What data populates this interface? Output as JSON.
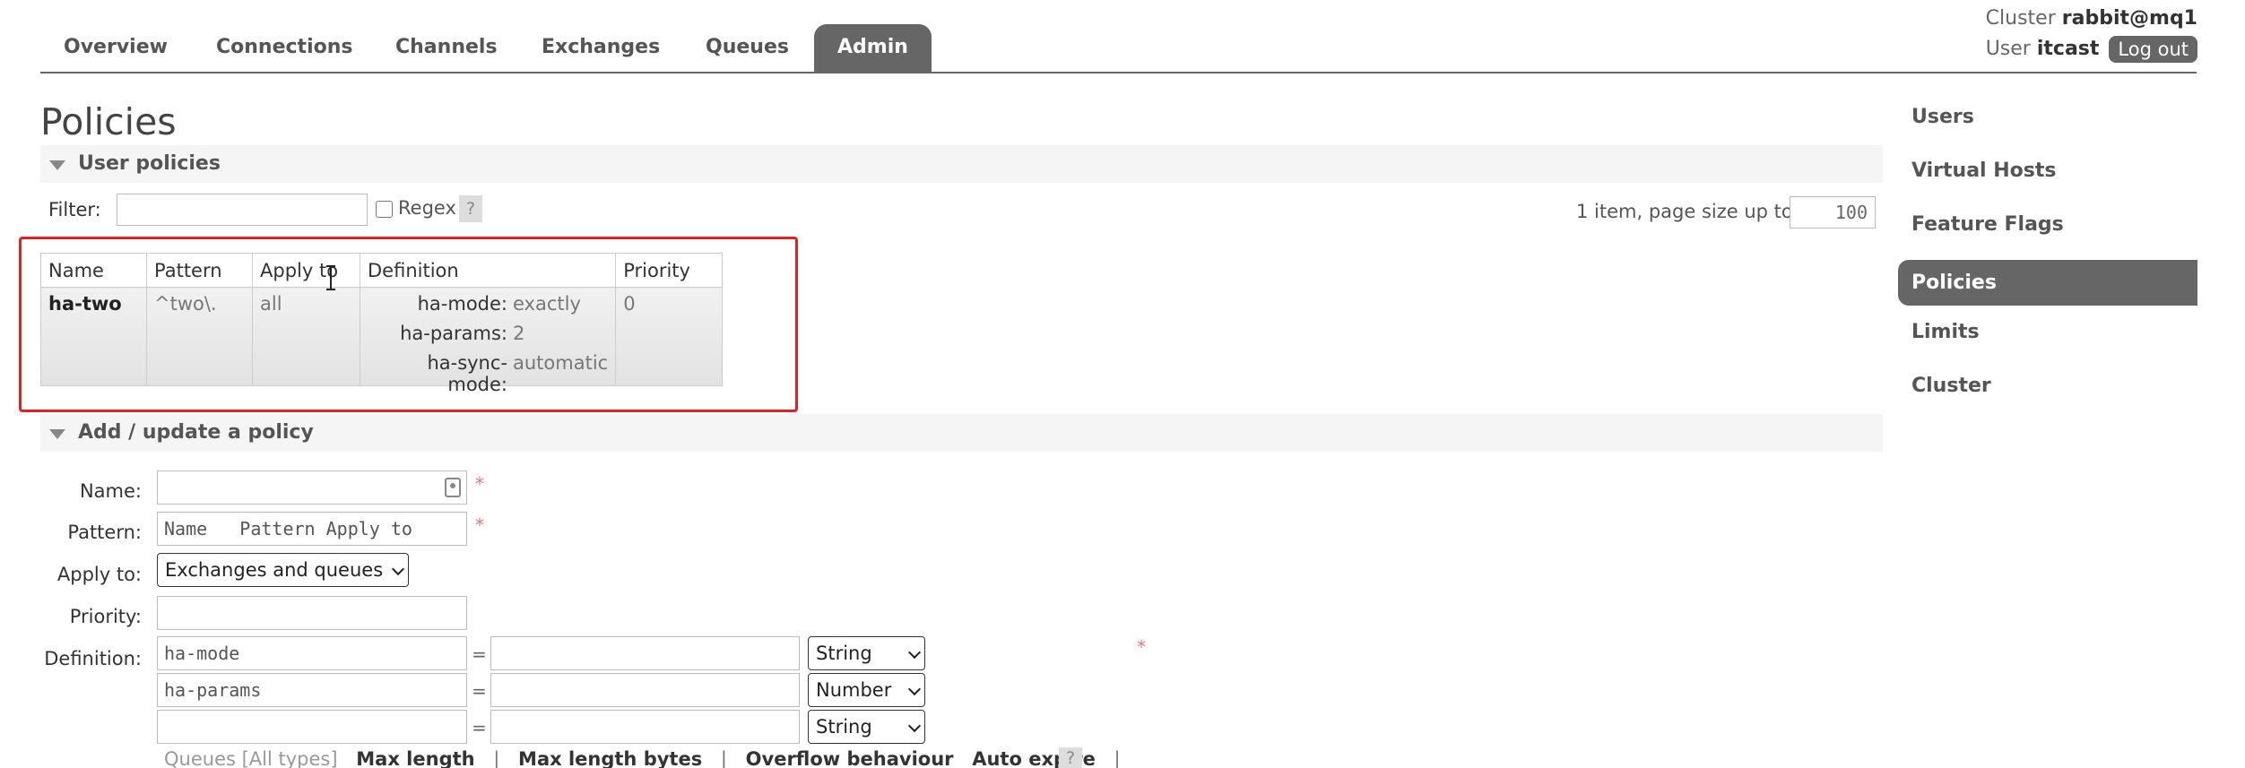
{
  "nav": {
    "tabs": [
      {
        "label": "Overview"
      },
      {
        "label": "Connections"
      },
      {
        "label": "Channels"
      },
      {
        "label": "Exchanges"
      },
      {
        "label": "Queues"
      },
      {
        "label": "Admin",
        "active": true
      }
    ]
  },
  "header": {
    "cluster_label": "Cluster",
    "cluster_name": "rabbit@mq1",
    "user_label": "User",
    "user_name": "itcast",
    "logout": "Log out"
  },
  "page": {
    "title": "Policies"
  },
  "user_policies": {
    "heading": "User policies",
    "filter_label": "Filter:",
    "filter_value": "",
    "regex_label": "Regex",
    "help": "?",
    "items_text": "1 item, page size up to",
    "page_size": "100",
    "table": {
      "headers": [
        "Name",
        "Pattern",
        "Apply to",
        "Definition",
        "Priority"
      ],
      "rows": [
        {
          "name": "ha-two",
          "pattern": "^two\\.",
          "apply_to": "all",
          "definition": [
            {
              "key": "ha-mode:",
              "value": "exactly"
            },
            {
              "key": "ha-params:",
              "value": "2"
            },
            {
              "key": "ha-sync-mode:",
              "value": "automatic"
            }
          ],
          "priority": "0"
        }
      ]
    }
  },
  "add_policy": {
    "heading": "Add / update a policy",
    "name_label": "Name:",
    "name_value": "",
    "pattern_label": "Pattern:",
    "pattern_value": "Name   Pattern Apply to",
    "apply_label": "Apply to:",
    "apply_value": "Exchanges and queues",
    "priority_label": "Priority:",
    "priority_value": "",
    "definition_label": "Definition:",
    "required_mark": "*",
    "eq": "=",
    "definitions": [
      {
        "key": "ha-mode",
        "value": "",
        "type": "String"
      },
      {
        "key": "ha-params",
        "value": "",
        "type": "Number"
      },
      {
        "key": "",
        "value": "",
        "type": "String"
      }
    ],
    "links": {
      "category": "Queues [All types]",
      "items": [
        "Max length",
        "Max length bytes",
        "Overflow behaviour",
        "Auto expire"
      ],
      "sep": "|",
      "help": "?"
    }
  },
  "sidebar": {
    "items": [
      {
        "label": "Users"
      },
      {
        "label": "Virtual Hosts"
      },
      {
        "label": "Feature Flags"
      },
      {
        "label": "Policies",
        "active": true
      },
      {
        "label": "Limits"
      },
      {
        "label": "Cluster"
      }
    ]
  },
  "colors": {
    "accent": "#666666",
    "highlight": "#e41f1f"
  }
}
